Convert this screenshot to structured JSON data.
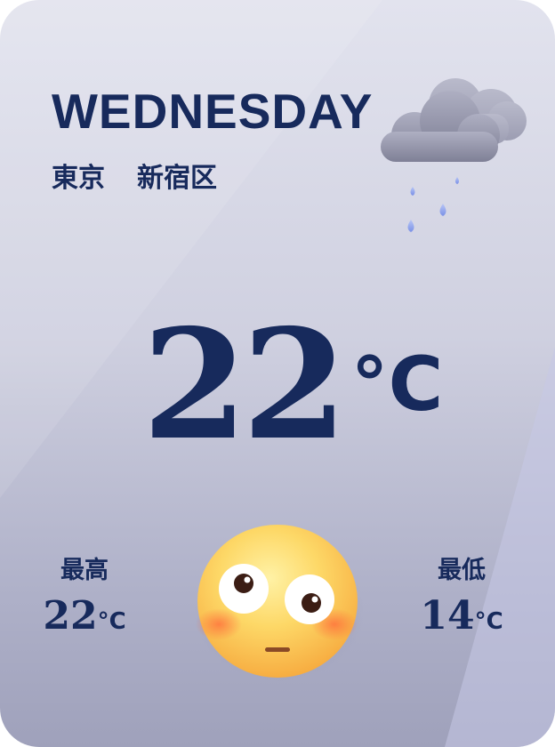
{
  "weekday": "WEDNESDAY",
  "location": {
    "city": "東京",
    "ward": "新宿区"
  },
  "current": {
    "temperature": "22",
    "unit": "°C"
  },
  "high": {
    "label": "最高",
    "value": "22",
    "unit": "°C"
  },
  "low": {
    "label": "最低",
    "value": "14",
    "unit": "°C"
  },
  "condition_icon": "rain-cloud-icon",
  "mood_icon": "flushed-face-icon",
  "colors": {
    "text": "#172a5c",
    "background_top": "#e2e3ee",
    "background_bottom": "#9fa1bb",
    "cloud": "#8e8fa3",
    "raindrop": "#8fa4ec",
    "face": "#fbc94f"
  }
}
